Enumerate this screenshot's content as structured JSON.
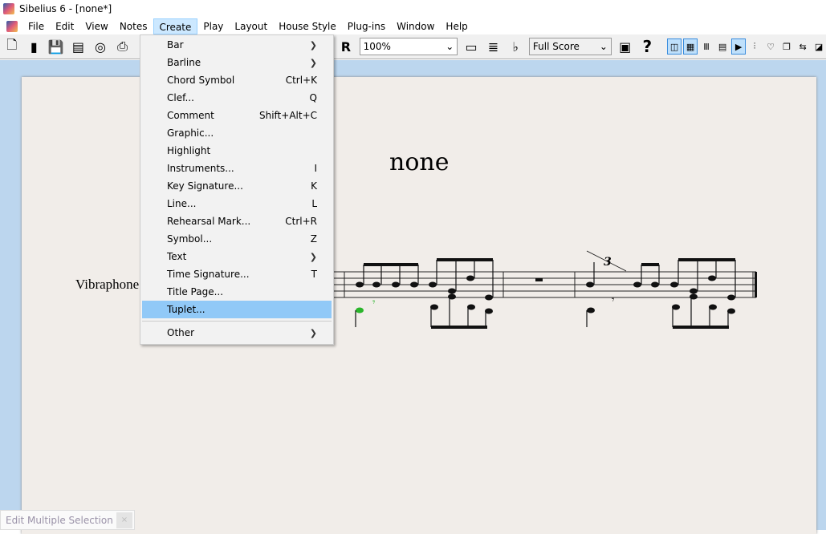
{
  "window": {
    "title": "Sibelius 6 - [none*]"
  },
  "menubar": [
    "File",
    "Edit",
    "View",
    "Notes",
    "Create",
    "Play",
    "Layout",
    "House Style",
    "Plug-ins",
    "Window",
    "Help"
  ],
  "toolbar": {
    "zoom": "100%",
    "score_view": "Full Score"
  },
  "score": {
    "title": "none",
    "instrument": "Vibraphone",
    "tuplet": "3"
  },
  "create_menu": [
    {
      "label": "Bar",
      "shortcut": "",
      "submenu": true
    },
    {
      "label": "Barline",
      "shortcut": "",
      "submenu": true
    },
    {
      "label": "Chord Symbol",
      "shortcut": "Ctrl+K"
    },
    {
      "label": "Clef...",
      "shortcut": "Q"
    },
    {
      "label": "Comment",
      "shortcut": "Shift+Alt+C"
    },
    {
      "label": "Graphic...",
      "shortcut": ""
    },
    {
      "label": "Highlight",
      "shortcut": ""
    },
    {
      "label": "Instruments...",
      "shortcut": "I"
    },
    {
      "label": "Key Signature...",
      "shortcut": "K"
    },
    {
      "label": "Line...",
      "shortcut": "L"
    },
    {
      "label": "Rehearsal Mark...",
      "shortcut": "Ctrl+R"
    },
    {
      "label": "Symbol...",
      "shortcut": "Z"
    },
    {
      "label": "Text",
      "shortcut": "",
      "submenu": true
    },
    {
      "label": "Time Signature...",
      "shortcut": "T"
    },
    {
      "label": "Title Page...",
      "shortcut": ""
    },
    {
      "label": "Tuplet...",
      "shortcut": "",
      "highlighted": true
    },
    {
      "label": "Other",
      "shortcut": "",
      "submenu": true,
      "separator_before": true
    }
  ],
  "float_window": {
    "title": "Edit Multiple Selection",
    "close": "×"
  },
  "colors": {
    "highlight": "#91c9f7",
    "workspace": "#bcd6ee",
    "paper": "#f1ede9",
    "selected_note": "#2bb52b"
  }
}
